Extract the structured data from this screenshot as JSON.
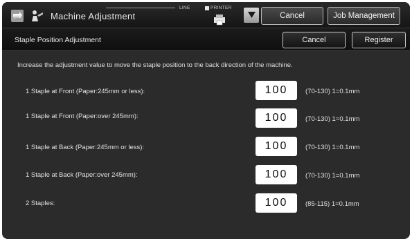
{
  "header": {
    "title": "Machine Adjustment",
    "line_label": "LINE",
    "printer_label": "PRINTER",
    "cancel_label": "Cancel",
    "job_management_label": "Job Management"
  },
  "subheader": {
    "title": "Staple Position Adjustment",
    "cancel_label": "Cancel",
    "register_label": "Register"
  },
  "main": {
    "instruction": "Increase the adjustment value to move the staple position to the back direction of the machine.",
    "rows": [
      {
        "label": "1 Staple at Front (Paper:245mm or less):",
        "value": "100",
        "range": "(70-130) 1=0.1mm"
      },
      {
        "label": "1 Staple at Front (Paper:over 245mm):",
        "value": "100",
        "range": "(70-130) 1=0.1mm"
      },
      {
        "label": "1 Staple at Back (Paper:245mm or less):",
        "value": "100",
        "range": "(70-130) 1=0.1mm"
      },
      {
        "label": "1 Staple at Back (Paper:over 245mm):",
        "value": "100",
        "range": "(70-130) 1=0.1mm"
      },
      {
        "label": "2 Staples:",
        "value": "100",
        "range": "(85-115) 1=0.1mm"
      }
    ]
  },
  "icons": {
    "app": "arrows-swap-icon",
    "title": "adjustment-person-icon",
    "printer": "printer-icon",
    "dropdown": "triangle-down-icon"
  }
}
